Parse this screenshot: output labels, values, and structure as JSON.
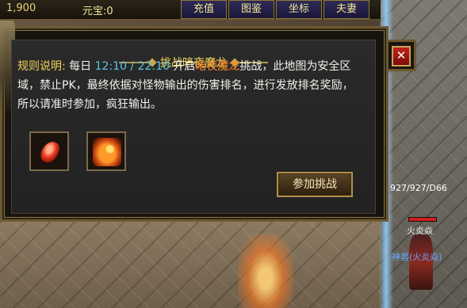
{
  "hud": {
    "gold_text": "1,900",
    "yuanbao_text": "元宝:0",
    "buttons": [
      {
        "label": "充值"
      },
      {
        "label": "图鉴"
      },
      {
        "label": "坐标"
      },
      {
        "label": "夫妻"
      }
    ]
  },
  "dialog": {
    "title": "挑战暗夜魔龙",
    "close_label": "✕",
    "desc": {
      "label": "规则说明:",
      "p1": " 每日 ",
      "time": "12:10 / 22:10",
      "p2": " 开启",
      "name": "暗夜魔龙",
      "p3": "挑战，此地图为安全区域，禁止PK，最终依据对怪物输出的伤害排名，进行发放排名奖励，所以请准时参加，疯狂输出。"
    },
    "rewards": [
      {
        "icon": "red-gem-icon"
      },
      {
        "icon": "fire-dragon-icon"
      }
    ],
    "join_label": "参加挑战"
  },
  "npc": {
    "hp_text": "927/927/D66",
    "hp_fraction": 1.0,
    "name": "火炎焱",
    "title": "神兽(火炎焱)"
  },
  "colors": {
    "title_gold": "#f0d35a",
    "time_cyan": "#5cc6e6",
    "boss_orange": "#ff8a2a",
    "npc_title_blue": "#6aa8ff"
  }
}
